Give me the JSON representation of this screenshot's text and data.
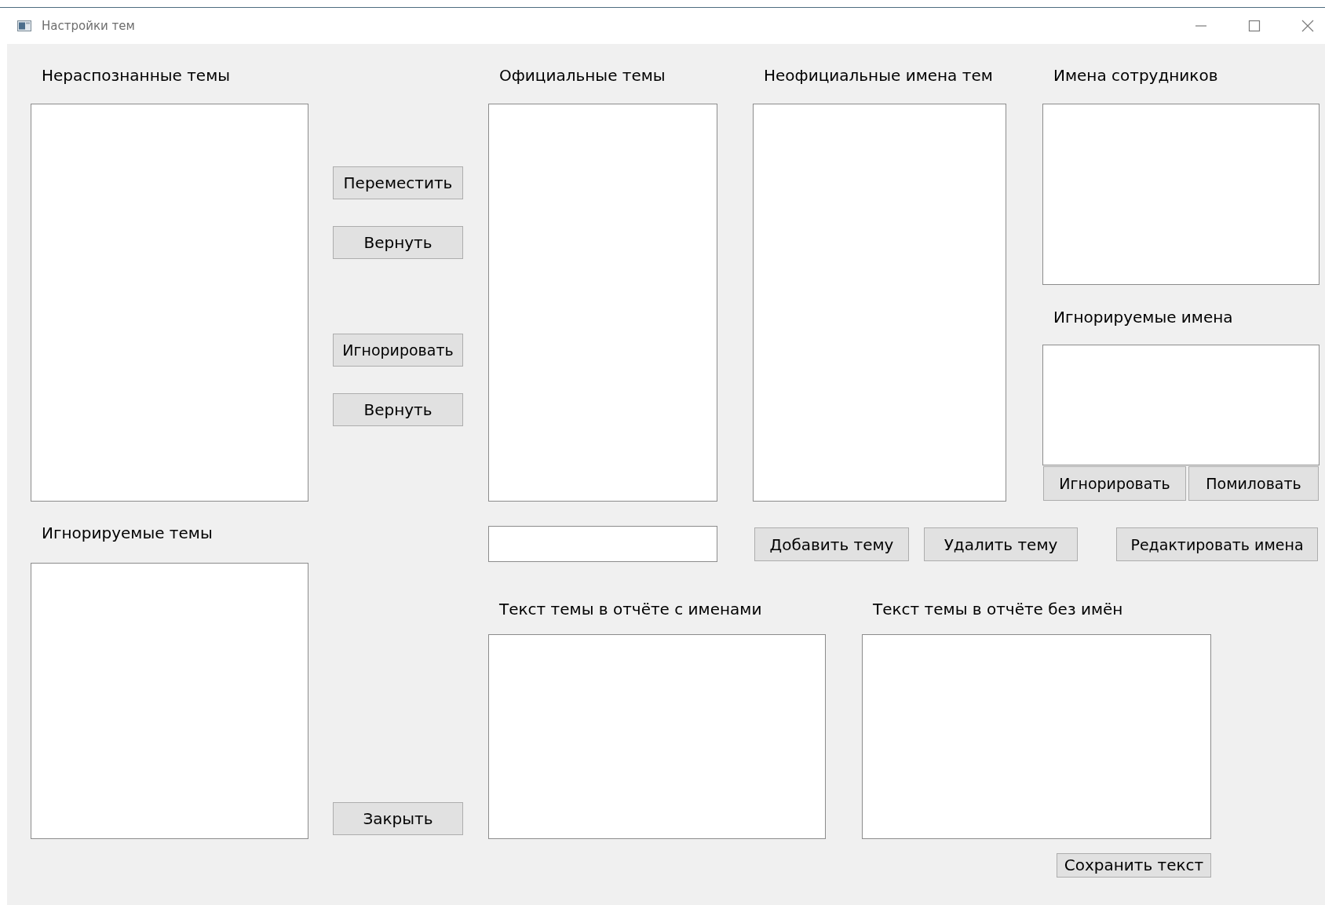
{
  "window": {
    "title": "Настройки тем"
  },
  "unrecognized_topics": {
    "label": "Нераспознанные темы"
  },
  "ignored_topics": {
    "label": "Игнорируемые темы"
  },
  "transfer_buttons": [
    "Переместить",
    "Вернуть",
    "Игнорировать",
    "Вернуть"
  ],
  "close_button": "Закрыть",
  "official_topics": {
    "label": "Официальные темы"
  },
  "unofficial_names": {
    "label": "Неофициальные имена тем"
  },
  "employee_names": {
    "label": "Имена сотрудников"
  },
  "ignored_names": {
    "label": "Игнорируемые имена",
    "buttons": [
      "Игнорировать",
      "Помиловать"
    ]
  },
  "topic_actions": [
    "Добавить тему",
    "Удалить тему",
    "Редактировать имена"
  ],
  "report_text_with_names": {
    "label": "Текст темы в отчёте с именами"
  },
  "report_text_without_names": {
    "label": "Текст темы в отчёте без имён"
  },
  "save_button": "Сохранить текст"
}
